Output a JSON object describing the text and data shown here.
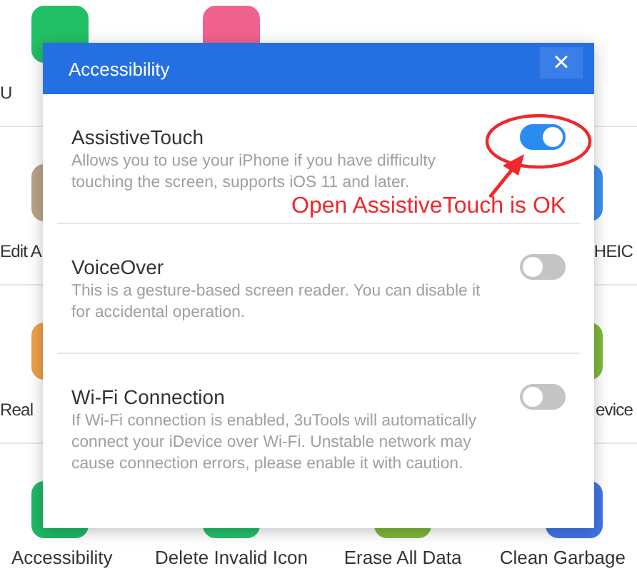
{
  "background_rows": [
    {
      "left": [
        {
          "color": "#21c066",
          "label": "U"
        },
        {
          "color": "#f0628e"
        }
      ]
    },
    {
      "left": [
        {
          "color": "#b9a487",
          "label": "Edit A"
        }
      ],
      "right": [
        {
          "color": "#3d8ff0",
          "label": "HEIC"
        }
      ]
    },
    {
      "left": [
        {
          "color": "#eea04a",
          "label": "Real"
        }
      ],
      "right": [
        {
          "color": "#7fb83a",
          "label": "evice"
        }
      ]
    },
    {
      "left": [
        {
          "color": "#1fb865",
          "label": "Accessibility"
        },
        {
          "color": "#22c06b",
          "label": "Delete Invalid Icon"
        },
        {
          "color": "#7fb83a",
          "label": "Erase All Data"
        },
        {
          "color": "#3f76e6",
          "label": "Clean Garbage"
        }
      ]
    }
  ],
  "dialog": {
    "title": "Accessibility",
    "close": "×",
    "settings": [
      {
        "title": "AssistiveTouch",
        "description": "Allows you to use your iPhone if you have difficulty touching the screen, supports iOS 11 and later.",
        "on": true
      },
      {
        "title": "VoiceOver",
        "description": "This is a gesture-based screen reader. You can disable it for accidental operation.",
        "on": false
      },
      {
        "title": "Wi-Fi Connection",
        "description": "If Wi-Fi connection is enabled, 3uTools will automatically connect your iDevice over Wi-Fi. Unstable network may cause connection errors, please enable it with caution.",
        "on": false
      }
    ]
  },
  "annotation": {
    "text": "Open AssistiveTouch is OK"
  }
}
